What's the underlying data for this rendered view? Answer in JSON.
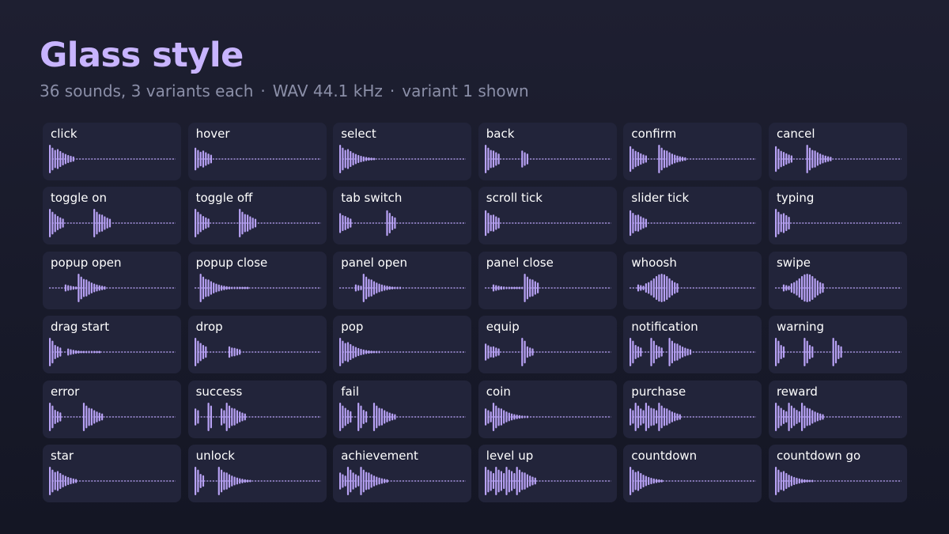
{
  "header": {
    "title": "Glass style",
    "subtitle_parts": [
      "36 sounds, 3 variants each",
      "WAV 44.1 kHz",
      "variant 1 shown"
    ]
  },
  "colors": {
    "accent": "#c8b4ff",
    "wave": "#b8a2f5",
    "card": "#22243a",
    "dash": "#b8a2f5"
  },
  "sounds": [
    {
      "label": "click",
      "profile": [
        [
          0,
          1.0,
          3
        ],
        [
          0,
          0.7,
          7
        ]
      ]
    },
    {
      "label": "hover",
      "profile": [
        [
          0,
          0.8,
          3
        ],
        [
          0,
          0.6,
          4
        ]
      ]
    },
    {
      "label": "select",
      "profile": [
        [
          0,
          1.0,
          3
        ],
        [
          0,
          0.7,
          11
        ]
      ]
    },
    {
      "label": "back",
      "profile": [
        [
          0,
          1.0,
          3
        ],
        [
          0,
          0.6,
          3
        ],
        [
          8,
          0.6,
          3
        ]
      ]
    },
    {
      "label": "confirm",
      "profile": [
        [
          0,
          0.9,
          3
        ],
        [
          0,
          0.5,
          4
        ],
        [
          4,
          1.0,
          3
        ],
        [
          0,
          0.6,
          8
        ]
      ]
    },
    {
      "label": "cancel",
      "profile": [
        [
          0,
          0.9,
          3
        ],
        [
          0,
          0.5,
          4
        ],
        [
          5,
          1.0,
          3
        ],
        [
          0,
          0.6,
          7
        ]
      ]
    },
    {
      "label": "toggle on",
      "profile": [
        [
          0,
          1.0,
          3
        ],
        [
          0,
          0.5,
          3
        ],
        [
          11,
          1.0,
          3
        ],
        [
          0,
          0.6,
          4
        ]
      ]
    },
    {
      "label": "toggle off",
      "profile": [
        [
          0,
          1.0,
          3
        ],
        [
          0,
          0.5,
          3
        ],
        [
          11,
          1.0,
          3
        ],
        [
          0,
          0.6,
          4
        ]
      ]
    },
    {
      "label": "tab switch",
      "profile": [
        [
          0,
          0.7,
          2
        ],
        [
          0,
          0.5,
          3
        ],
        [
          13,
          0.9,
          2
        ],
        [
          0,
          0.5,
          2
        ]
      ]
    },
    {
      "label": "scroll tick",
      "profile": [
        [
          0,
          0.9,
          3
        ],
        [
          0,
          0.6,
          3
        ]
      ]
    },
    {
      "label": "slider tick",
      "profile": [
        [
          0,
          0.9,
          3
        ],
        [
          0,
          0.6,
          4
        ]
      ]
    },
    {
      "label": "typing",
      "profile": [
        [
          0,
          1.0,
          3
        ],
        [
          0,
          0.7,
          3
        ]
      ]
    },
    {
      "label": "popup open",
      "profile": [
        [
          6,
          0.25,
          5
        ],
        [
          0,
          1.0,
          3
        ],
        [
          0,
          0.6,
          8
        ]
      ]
    },
    {
      "label": "popup close",
      "profile": [
        [
          2,
          1.0,
          3
        ],
        [
          0,
          0.6,
          16
        ]
      ]
    },
    {
      "label": "panel open",
      "profile": [
        [
          6,
          0.25,
          3
        ],
        [
          0,
          1.0,
          3
        ],
        [
          0,
          0.6,
          12
        ]
      ]
    },
    {
      "label": "panel close",
      "profile": [
        [
          3,
          0.25,
          12
        ],
        [
          0,
          1.0,
          3
        ],
        [
          0,
          0.6,
          3
        ]
      ]
    },
    {
      "label": "whoosh",
      "profile": [
        [
          3,
          0.25,
          3
        ],
        [
          0,
          1.0,
          13,
          "bell"
        ]
      ]
    },
    {
      "label": "swipe",
      "profile": [
        [
          3,
          0.25,
          3
        ],
        [
          0,
          1.0,
          13,
          "bell"
        ]
      ]
    },
    {
      "label": "drag start",
      "profile": [
        [
          0,
          1.0,
          2
        ],
        [
          0,
          0.5,
          3
        ],
        [
          2,
          0.25,
          13
        ]
      ]
    },
    {
      "label": "drop",
      "profile": [
        [
          0,
          1.0,
          3
        ],
        [
          0,
          0.5,
          2
        ],
        [
          8,
          0.4,
          2
        ],
        [
          0,
          0.3,
          3
        ]
      ]
    },
    {
      "label": "pop",
      "profile": [
        [
          0,
          1.0,
          3
        ],
        [
          0,
          0.7,
          13
        ]
      ]
    },
    {
      "label": "equip",
      "profile": [
        [
          0,
          0.6,
          3
        ],
        [
          0,
          0.4,
          3
        ],
        [
          8,
          1.0,
          2
        ],
        [
          0,
          0.4,
          3
        ]
      ]
    },
    {
      "label": "notification",
      "profile": [
        [
          0,
          1.0,
          2
        ],
        [
          0,
          0.5,
          3
        ],
        [
          3,
          1.0,
          2
        ],
        [
          0,
          0.5,
          3
        ],
        [
          2,
          1.0,
          3
        ],
        [
          0,
          0.6,
          6
        ]
      ]
    },
    {
      "label": "warning",
      "profile": [
        [
          0,
          1.0,
          2
        ],
        [
          0,
          0.5,
          2
        ],
        [
          7,
          1.0,
          2
        ],
        [
          0,
          0.5,
          2
        ],
        [
          7,
          1.0,
          2
        ],
        [
          0,
          0.5,
          2
        ]
      ]
    },
    {
      "label": "error",
      "profile": [
        [
          0,
          1.0,
          2
        ],
        [
          0,
          0.5,
          3
        ],
        [
          8,
          1.0,
          3
        ],
        [
          0,
          0.6,
          5
        ]
      ]
    },
    {
      "label": "success",
      "profile": [
        [
          0,
          0.6,
          2
        ],
        [
          3,
          1.0,
          2
        ],
        [
          3,
          0.6,
          2
        ],
        [
          0,
          1.0,
          3
        ],
        [
          0,
          0.6,
          5
        ]
      ]
    },
    {
      "label": "fail",
      "profile": [
        [
          0,
          1.0,
          3
        ],
        [
          0,
          0.5,
          2
        ],
        [
          2,
          1.0,
          2
        ],
        [
          0,
          0.5,
          2
        ],
        [
          2,
          1.0,
          3
        ],
        [
          0,
          0.6,
          6
        ]
      ]
    },
    {
      "label": "coin",
      "profile": [
        [
          0,
          0.6,
          3
        ],
        [
          0,
          1.0,
          3
        ],
        [
          0,
          0.6,
          11
        ]
      ]
    },
    {
      "label": "purchase",
      "profile": [
        [
          0,
          0.6,
          2
        ],
        [
          0,
          1.0,
          2
        ],
        [
          0,
          0.6,
          2
        ],
        [
          0,
          1.0,
          3
        ],
        [
          0,
          0.6,
          2
        ],
        [
          0,
          1.0,
          3
        ],
        [
          0,
          0.6,
          6
        ]
      ]
    },
    {
      "label": "reward",
      "profile": [
        [
          0,
          1.0,
          3
        ],
        [
          0,
          0.5,
          2
        ],
        [
          0,
          1.0,
          3
        ],
        [
          0,
          0.5,
          2
        ],
        [
          0,
          1.0,
          3
        ],
        [
          0,
          0.6,
          6
        ]
      ]
    },
    {
      "label": "star",
      "profile": [
        [
          0,
          1.0,
          3
        ],
        [
          0,
          0.7,
          8
        ]
      ]
    },
    {
      "label": "unlock",
      "profile": [
        [
          0,
          1.0,
          2
        ],
        [
          0,
          0.5,
          2
        ],
        [
          5,
          1.0,
          3
        ],
        [
          0,
          0.6,
          10
        ]
      ]
    },
    {
      "label": "achievement",
      "profile": [
        [
          0,
          0.6,
          3
        ],
        [
          0,
          1.0,
          2
        ],
        [
          0,
          0.6,
          3
        ],
        [
          0,
          1.0,
          3
        ],
        [
          0,
          0.6,
          8
        ]
      ]
    },
    {
      "label": "level up",
      "profile": [
        [
          0,
          1.0,
          2
        ],
        [
          0,
          0.7,
          2
        ],
        [
          0,
          1.0,
          2
        ],
        [
          0,
          0.7,
          2
        ],
        [
          0,
          1.0,
          2
        ],
        [
          0,
          0.7,
          2
        ],
        [
          0,
          1.0,
          3
        ],
        [
          0,
          0.6,
          5
        ]
      ]
    },
    {
      "label": "countdown",
      "profile": [
        [
          0,
          1.0,
          3
        ],
        [
          0,
          0.7,
          10
        ]
      ]
    },
    {
      "label": "countdown go",
      "profile": [
        [
          0,
          1.0,
          3
        ],
        [
          0,
          0.7,
          12
        ]
      ]
    }
  ]
}
